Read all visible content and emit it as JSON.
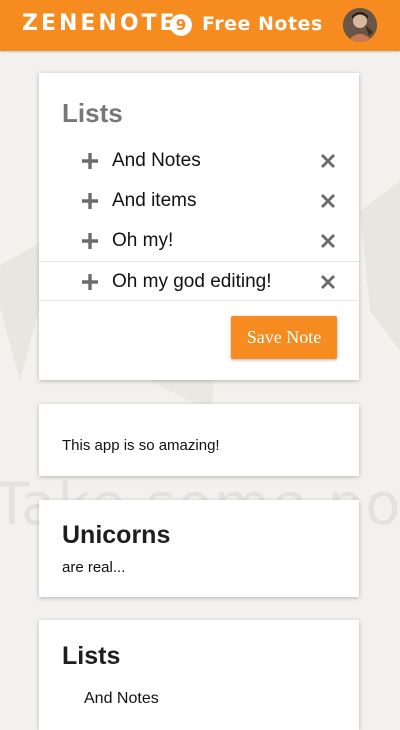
{
  "header": {
    "logo_text": "ZENENOTE",
    "logo_badge": "9",
    "title": "Free Notes",
    "avatar_icon": "user-avatar"
  },
  "background": {
    "watermark": "Take some notes"
  },
  "cards": {
    "list_card": {
      "title": "Lists",
      "items": [
        {
          "label": "And Notes"
        },
        {
          "label": "And items"
        },
        {
          "label": "Oh my!"
        },
        {
          "label": "Oh my god editing!"
        }
      ],
      "save_label": "Save Note"
    },
    "note_card": {
      "text": "This app is so amazing!"
    },
    "unicorn_card": {
      "title": "Unicorns",
      "text": "are real..."
    },
    "list_card_2": {
      "title": "Lists",
      "items": [
        {
          "label": "And Notes"
        }
      ]
    }
  },
  "colors": {
    "accent": "#f68b1f",
    "background": "#f3f1ee",
    "icon_gray": "#6b6b6b"
  }
}
